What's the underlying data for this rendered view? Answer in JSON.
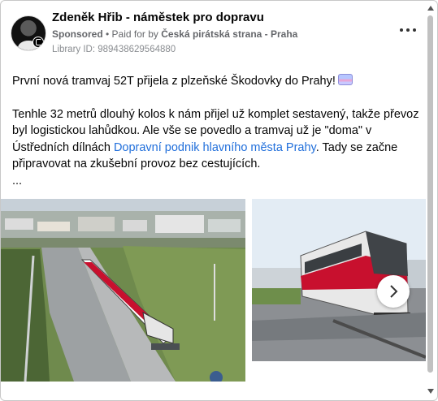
{
  "post": {
    "author": "Zdeněk Hřib - náměstek pro dopravu",
    "sponsored": "Sponsored",
    "paid_for_prefix": " • Paid for by ",
    "funder": "Česká pirátská strana - Praha",
    "library_id": "Library ID: 989438629564880",
    "headline": "První nová tramvaj 52T přijela z plzeňské Škodovky do Prahy!",
    "paragraph_part1": "Tenhle 32 metrů dlouhý kolos k nám přijel už komplet sestavený, takže převoz byl logistickou lahůdkou. Ale vše se povedlo a tramvaj už je \"doma\" v Ústředních dílnách ",
    "paragraph_link": "Dopravní podnik hlavního města Prahy",
    "paragraph_part2": ". Tady se začne připravovat na zkušební provoz bez cestujících.",
    "ellipsis": "...",
    "emoji": "tram-emoji"
  },
  "icons": {
    "more": "more-options-icon",
    "next": "chevron-right-icon",
    "scroll_up": "scroll-up-icon",
    "scroll_down": "scroll-down-icon"
  },
  "colors": {
    "link": "#216fdb",
    "meta": "#65676b",
    "tram_red": "#c8102e"
  }
}
